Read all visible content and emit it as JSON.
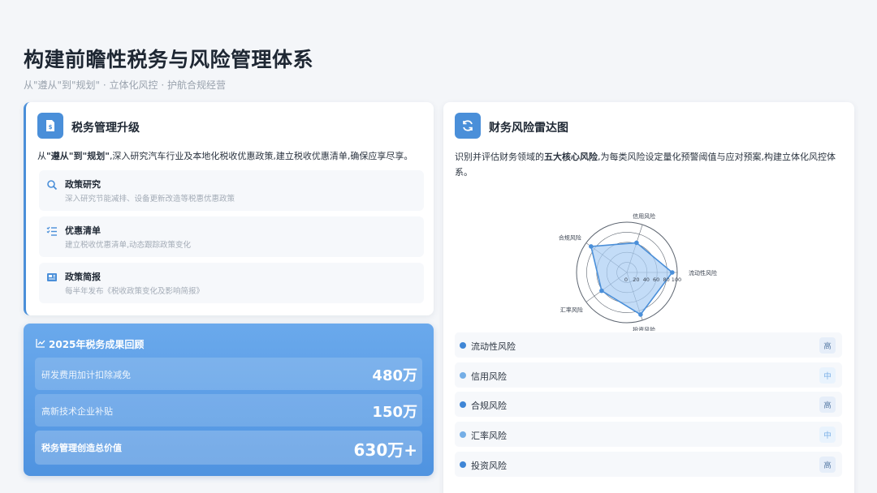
{
  "page": {
    "title": "构建前瞻性税务与风险管理体系",
    "subtitle": "从\"遵从\"到\"规划\" · 立体化风控 · 护航合规经营"
  },
  "tax_card": {
    "title": "税务管理升级",
    "desc_prefix": "从",
    "desc_bold": "\"遵从\"到\"规划\"",
    "desc_rest": ",深入研究汽车行业及本地化税收优惠政策,建立税收优惠清单,确保应享尽享。",
    "items": [
      {
        "icon": "search-icon",
        "title": "政策研究",
        "desc": "深入研究节能减排、设备更新改造等税惠优惠政策"
      },
      {
        "icon": "checklist-icon",
        "title": "优惠清单",
        "desc": "建立税收优惠清单,动态跟踪政策变化"
      },
      {
        "icon": "newspaper-icon",
        "title": "政策简报",
        "desc": "每半年发布《税收政策变化及影响简报》"
      }
    ]
  },
  "stats_card": {
    "title": "2025年税务成果回顾",
    "rows": [
      {
        "label": "研发费用加计扣除减免",
        "value": "480万"
      },
      {
        "label": "高新技术企业补贴",
        "value": "150万"
      }
    ],
    "total": {
      "label": "税务管理创造总价值",
      "value": "630万+"
    }
  },
  "risk_card": {
    "title": "财务风险雷达图",
    "desc_prefix": "识别并评估财务领域的",
    "desc_bold": "五大核心风险",
    "desc_rest": ",为每类风险设定量化预警阈值与应对预案,构建立体化风控体系。",
    "risks": [
      {
        "name": "流动性风险",
        "level": "高",
        "dot_color": "#3f86d6",
        "level_class": "high"
      },
      {
        "name": "信用风险",
        "level": "中",
        "dot_color": "#74aee6",
        "level_class": "mid"
      },
      {
        "name": "合规风险",
        "level": "高",
        "dot_color": "#3f86d6",
        "level_class": "high"
      },
      {
        "name": "汇率风险",
        "level": "中",
        "dot_color": "#74aee6",
        "level_class": "mid"
      },
      {
        "name": "投资风险",
        "level": "高",
        "dot_color": "#3f86d6",
        "level_class": "high"
      }
    ]
  },
  "chart_data": {
    "type": "radar",
    "axes": [
      "流动性风险",
      "信用风险",
      "合规风险",
      "汇率风险",
      "投资风险"
    ],
    "ticks": [
      "0",
      "20",
      "40",
      "60",
      "80",
      "100"
    ],
    "range": [
      0,
      100
    ],
    "values": [
      90,
      62,
      88,
      62,
      88
    ],
    "fill_color": "#a9cdf3",
    "line_color": "#4a8fd9"
  },
  "colors": {
    "accent": "#4a8fd9",
    "stats_bg": "#5a9de6"
  }
}
